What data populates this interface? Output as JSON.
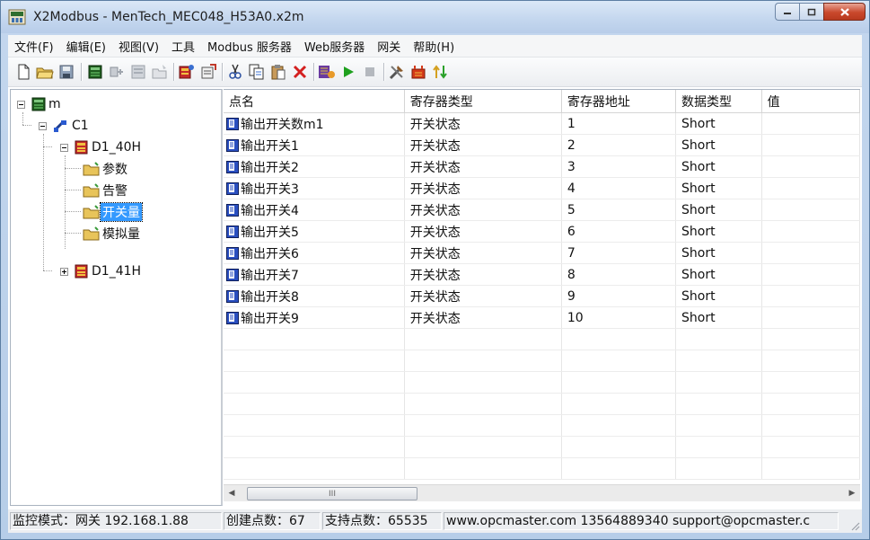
{
  "window": {
    "title": "X2Modbus - MenTech_MEC048_H53A0.x2m"
  },
  "menu": [
    "文件(F)",
    "编辑(E)",
    "视图(V)",
    "工具",
    "Modbus 服务器",
    "Web服务器",
    "网关",
    "帮助(H)"
  ],
  "toolbar": {
    "icons": [
      "new-file-icon",
      "open-folder-icon",
      "save-icon",
      "add-channel-icon",
      "add-device-icon",
      "add-group-icon",
      "properties-icon",
      "add-point-icon",
      "point-properties-icon",
      "cut-icon",
      "copy-icon",
      "paste-icon",
      "delete-icon",
      "monitor-icon",
      "run-icon",
      "stop-icon",
      "tools-icon",
      "modbus-icon",
      "swap-icon"
    ]
  },
  "tree": {
    "root": "m",
    "channel": "C1",
    "device1": "D1_40H",
    "groups": [
      "参数",
      "告警",
      "开关量",
      "模拟量"
    ],
    "selected_group": "开关量",
    "device2": "D1_41H"
  },
  "table": {
    "columns": [
      "点名",
      "寄存器类型",
      "寄存器地址",
      "数据类型",
      "值"
    ],
    "rows": [
      [
        "输出开关数m1",
        "开关状态",
        "1",
        "Short",
        ""
      ],
      [
        "输出开关1",
        "开关状态",
        "2",
        "Short",
        ""
      ],
      [
        "输出开关2",
        "开关状态",
        "3",
        "Short",
        ""
      ],
      [
        "输出开关3",
        "开关状态",
        "4",
        "Short",
        ""
      ],
      [
        "输出开关4",
        "开关状态",
        "5",
        "Short",
        ""
      ],
      [
        "输出开关5",
        "开关状态",
        "6",
        "Short",
        ""
      ],
      [
        "输出开关6",
        "开关状态",
        "7",
        "Short",
        ""
      ],
      [
        "输出开关7",
        "开关状态",
        "8",
        "Short",
        ""
      ],
      [
        "输出开关8",
        "开关状态",
        "9",
        "Short",
        ""
      ],
      [
        "输出开关9",
        "开关状态",
        "10",
        "Short",
        ""
      ]
    ]
  },
  "scrollbar": {
    "thumb_glyph": "III"
  },
  "status": {
    "mode": "监控模式：网关 192.168.1.88",
    "created": "创建点数：67",
    "supported": "支持点数：65535",
    "contact": "www.opcmaster.com 13564889340 support@opcmaster.c"
  },
  "colors": {
    "selection": "#3399ff",
    "titlebar": "#c3d6ee",
    "close_button": "#c9482c"
  }
}
